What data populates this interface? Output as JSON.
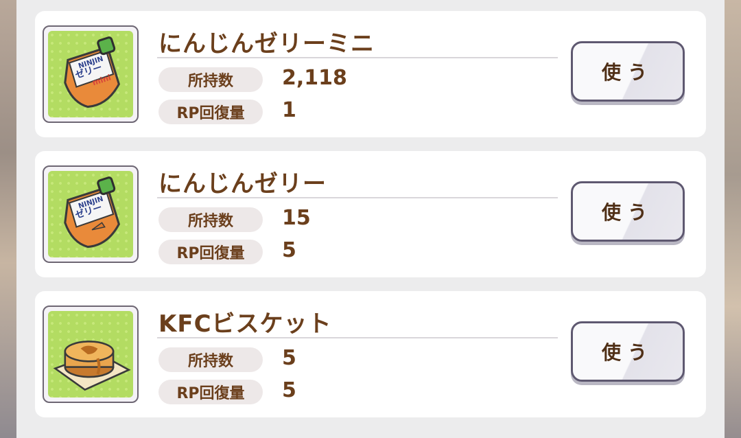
{
  "items": [
    {
      "name": "にんじんゼリーミニ",
      "owned_label": "所持数",
      "owned_value": "2,118",
      "rp_label": "RP回復量",
      "rp_value": "1",
      "use_label": "使う",
      "icon": "carrot-jelly-mini-icon",
      "package_brand": "NINJIN",
      "package_text": "ゼリー",
      "package_tag": "mini"
    },
    {
      "name": "にんじんゼリー",
      "owned_label": "所持数",
      "owned_value": "15",
      "rp_label": "RP回復量",
      "rp_value": "5",
      "use_label": "使う",
      "icon": "carrot-jelly-icon",
      "package_brand": "NINJIN",
      "package_text": "ゼリー"
    },
    {
      "name": "KFCビスケット",
      "owned_label": "所持数",
      "owned_value": "5",
      "rp_label": "RP回復量",
      "rp_value": "5",
      "use_label": "使う",
      "icon": "biscuit-icon"
    }
  ],
  "colors": {
    "text_brown": "#6b3f1c",
    "panel_bg": "#ececed",
    "icon_bg_green": "#bfe470",
    "button_border": "#5e5870"
  }
}
